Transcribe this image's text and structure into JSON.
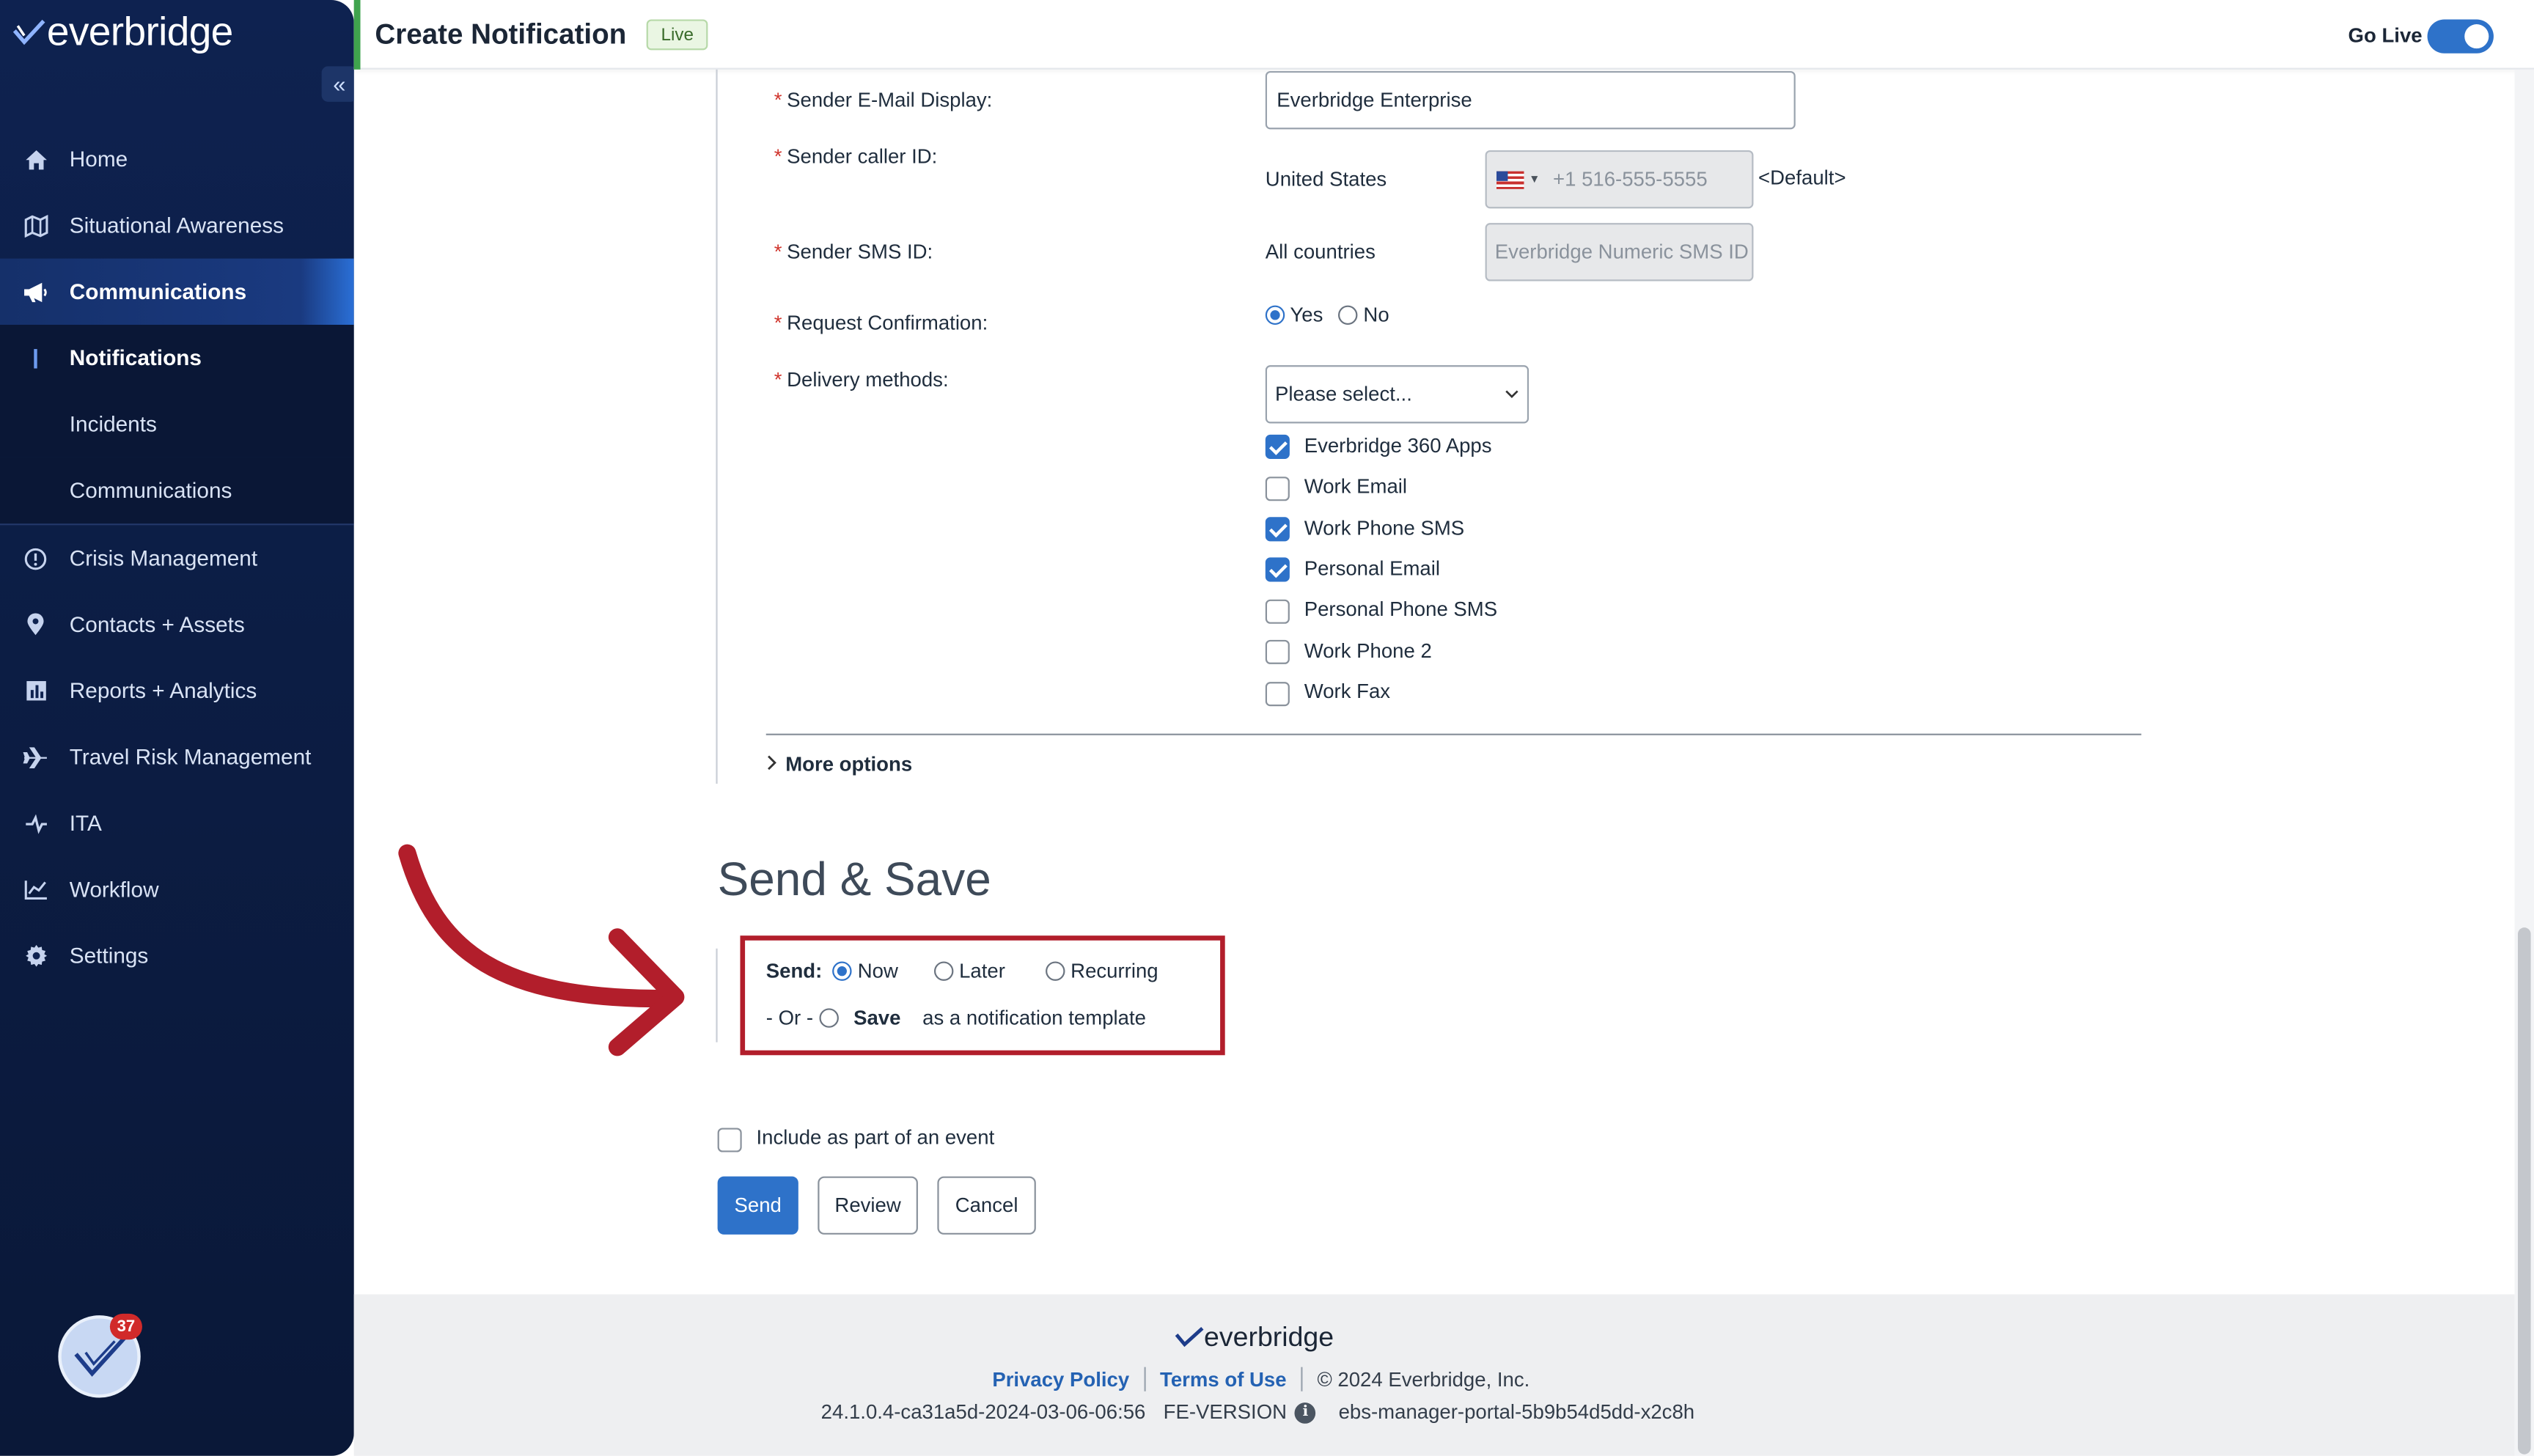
{
  "app": {
    "logo_text": "everbridge",
    "page_title": "Create Notification",
    "status_pill": "Live",
    "go_live_label": "Go Live",
    "go_live_on": true,
    "notification_count": "37"
  },
  "sidebar": {
    "collapse_glyph": "«",
    "items": [
      {
        "label": "Home",
        "icon": "home-icon"
      },
      {
        "label": "Situational Awareness",
        "icon": "map-icon"
      },
      {
        "label": "Communications",
        "icon": "megaphone-icon",
        "active": true
      },
      {
        "label": "Notifications",
        "sub": true,
        "current": true
      },
      {
        "label": "Incidents",
        "sub": true
      },
      {
        "label": "Communications",
        "sub": true
      },
      {
        "label": "Crisis Management",
        "icon": "alert-circle-icon"
      },
      {
        "label": "Contacts + Assets",
        "icon": "location-pin-icon"
      },
      {
        "label": "Reports + Analytics",
        "icon": "bar-chart-icon"
      },
      {
        "label": "Travel Risk Management",
        "icon": "plane-icon"
      },
      {
        "label": "ITA",
        "icon": "ita-icon"
      },
      {
        "label": "Workflow",
        "icon": "line-chart-icon"
      },
      {
        "label": "Settings",
        "icon": "gear-icon"
      }
    ]
  },
  "form": {
    "sender_email_label": "Sender E-Mail Display:",
    "sender_email_value": "Everbridge Enterprise",
    "caller_id_label": "Sender caller ID:",
    "caller_country": "United States",
    "caller_placeholder": "+1 516-555-5555",
    "caller_default": "<Default>",
    "sms_id_label": "Sender SMS ID:",
    "sms_country": "All countries",
    "sms_placeholder": "Everbridge Numeric SMS ID",
    "confirm_label": "Request Confirmation:",
    "confirm_yes": "Yes",
    "confirm_no": "No",
    "confirm_value": "Yes",
    "delivery_label": "Delivery methods:",
    "delivery_select": "Please select...",
    "delivery_methods": [
      {
        "label": "Everbridge 360 Apps",
        "checked": true
      },
      {
        "label": "Work Email",
        "checked": false
      },
      {
        "label": "Work Phone SMS",
        "checked": true
      },
      {
        "label": "Personal Email",
        "checked": true
      },
      {
        "label": "Personal Phone SMS",
        "checked": false
      },
      {
        "label": "Work Phone 2",
        "checked": false
      },
      {
        "label": "Work Fax",
        "checked": false
      }
    ],
    "more_options": "More options"
  },
  "send_save": {
    "title": "Send & Save",
    "send_label": "Send:",
    "now": "Now",
    "later": "Later",
    "recurring": "Recurring",
    "selected": "Now",
    "or_label": "- Or -",
    "save_label": "Save",
    "save_suffix": "as a notification template",
    "include_event": "Include as part of an event",
    "send_btn": "Send",
    "review_btn": "Review",
    "cancel_btn": "Cancel"
  },
  "footer": {
    "logo_text": "everbridge",
    "privacy": "Privacy Policy",
    "terms": "Terms of Use",
    "copyright": "© 2024 Everbridge, Inc.",
    "build": "24.1.0.4-ca31a5d-2024-03-06-06:56",
    "fe_version": "FE-VERSION",
    "instance": "ebs-manager-portal-5b9b54d5dd-x2c8h"
  },
  "colors": {
    "sidebar_bg": "#0e2250",
    "accent_blue": "#2e72c9",
    "highlight_red": "#b21e2b",
    "live_green": "#3fa34d"
  }
}
